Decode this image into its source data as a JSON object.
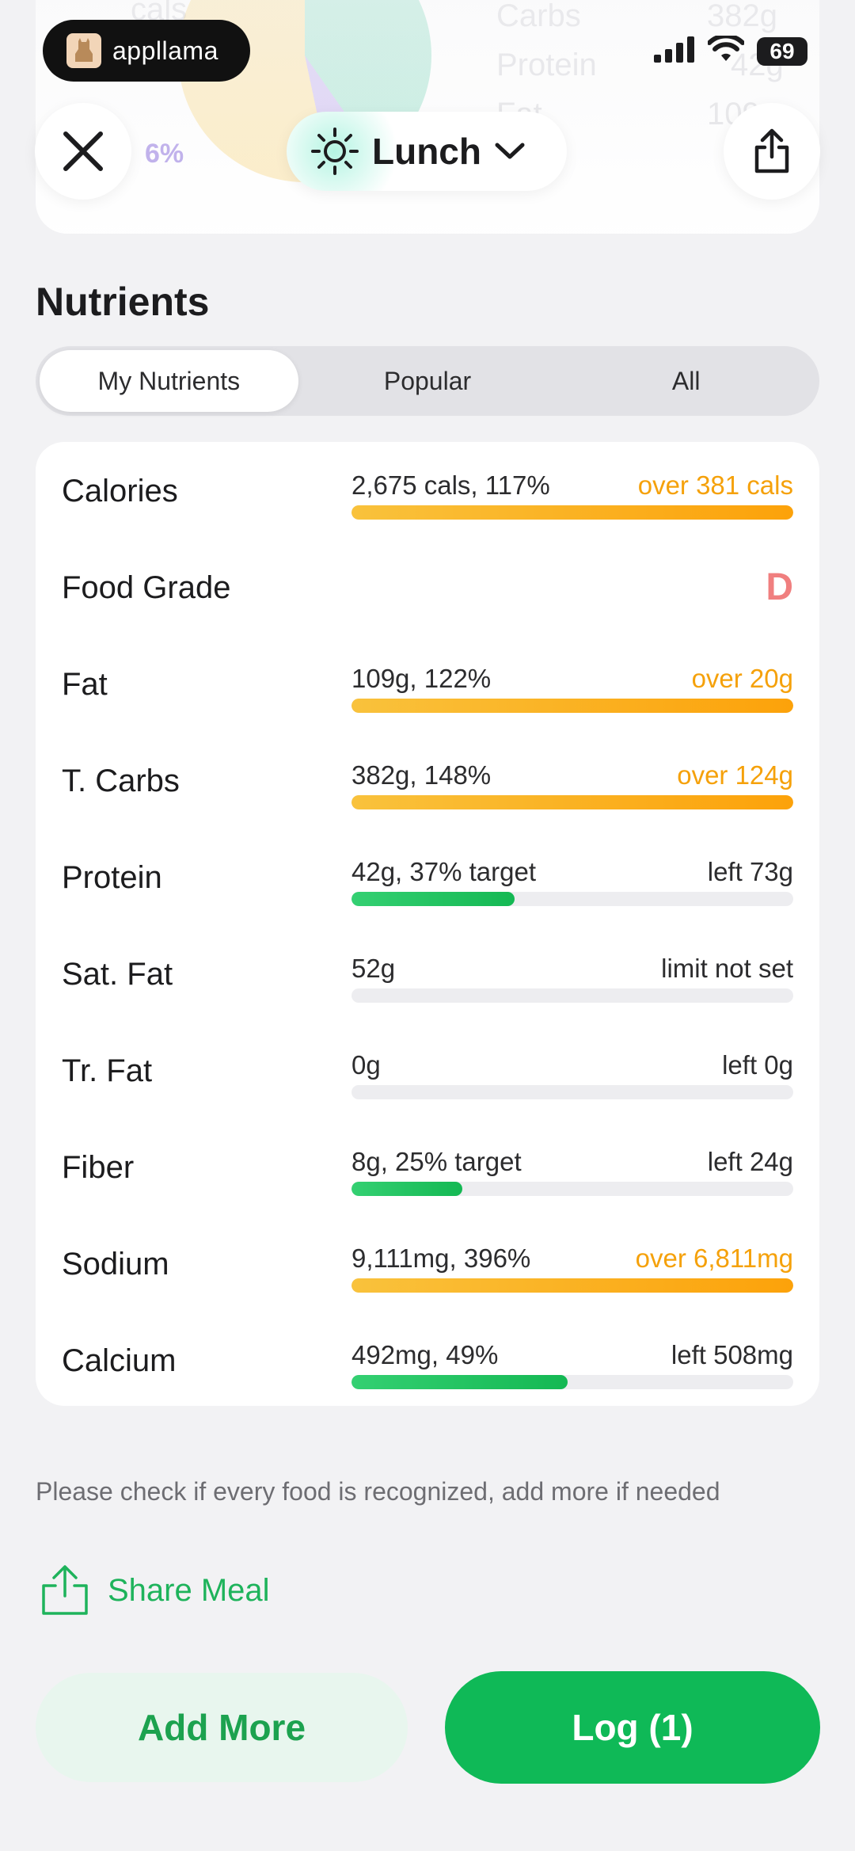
{
  "status_bar": {
    "carrier": "appllama",
    "battery": "69"
  },
  "summary_ghost": {
    "top_label": "cals",
    "slice_pct": "6%",
    "rows": [
      {
        "label": "Carbs",
        "value": "382g"
      },
      {
        "label": "Protein",
        "value": "42g"
      },
      {
        "label": "Fat",
        "value": "109g"
      }
    ]
  },
  "header": {
    "meal": "Lunch"
  },
  "nutrients": {
    "title": "Nutrients",
    "tabs": [
      "My Nutrients",
      "Popular",
      "All"
    ],
    "active_tab": 0,
    "rows": [
      {
        "name": "Calories",
        "value": "2,675 cals, 117%",
        "right": "over 381 cals",
        "status": "over",
        "progress": 1.0
      },
      {
        "name": "Food Grade",
        "grade": "D"
      },
      {
        "name": "Fat",
        "value": "109g, 122%",
        "right": "over 20g",
        "status": "over",
        "progress": 1.0
      },
      {
        "name": "T. Carbs",
        "value": "382g, 148%",
        "right": "over 124g",
        "status": "over",
        "progress": 1.0
      },
      {
        "name": "Protein",
        "value": "42g, 37% target",
        "right": "left 73g",
        "status": "under",
        "progress": 0.37
      },
      {
        "name": "Sat. Fat",
        "value": "52g",
        "right": "limit not set",
        "status": "none",
        "progress": 0
      },
      {
        "name": "Tr. Fat",
        "value": "0g",
        "right": "left 0g",
        "status": "none",
        "progress": 0
      },
      {
        "name": "Fiber",
        "value": "8g, 25% target",
        "right": "left 24g",
        "status": "under",
        "progress": 0.25
      },
      {
        "name": "Sodium",
        "value": "9,111mg, 396%",
        "right": "over 6,811mg",
        "status": "over",
        "progress": 1.0
      },
      {
        "name": "Calcium",
        "value": "492mg, 49%",
        "right": "left 508mg",
        "status": "under",
        "progress": 0.49
      }
    ]
  },
  "hint": "Please check if every food is recognized, add more if needed",
  "share_meal": "Share Meal",
  "buttons": {
    "add_more": "Add More",
    "log": "Log (1)"
  },
  "colors": {
    "accent_green": "#0fb957",
    "over_orange": "#f5a10a",
    "grade_red": "#f07f7f"
  },
  "icons": [
    "close-icon",
    "sun-icon",
    "chevron-down-icon",
    "share-icon"
  ]
}
